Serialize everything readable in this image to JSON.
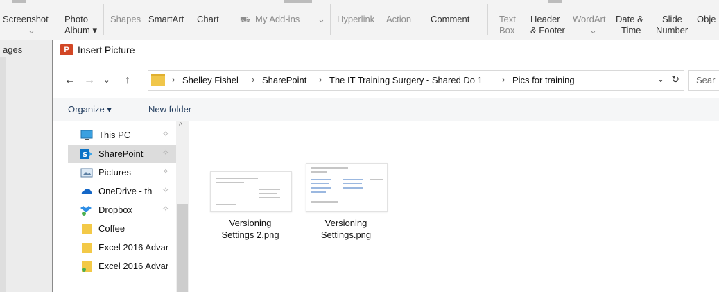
{
  "ribbon": {
    "screenshot": "Screenshot",
    "photo_album_l1": "Photo",
    "photo_album_l2": "Album ▾",
    "shapes": "Shapes",
    "smartart": "SmartArt",
    "chart": "Chart",
    "my_addins": "My Add-ins",
    "hyperlink": "Hyperlink",
    "action": "Action",
    "comment": "Comment",
    "text_box_l1": "Text",
    "text_box_l2": "Box",
    "header_footer_l1": "Header",
    "header_footer_l2": "& Footer",
    "wordart": "WordArt",
    "date_time_l1": "Date &",
    "date_time_l2": "Time",
    "slide_number_l1": "Slide",
    "slide_number_l2": "Number",
    "object": "Obje"
  },
  "background": {
    "panel_label": "ages"
  },
  "dialog": {
    "logo_text": "P",
    "title": "Insert Picture",
    "address": {
      "crumbs": [
        "Shelley Fishel",
        "SharePoint",
        "The IT Training Surgery - Shared Do 1",
        "Pics for training"
      ],
      "search_placeholder": "Sear"
    },
    "toolbar": {
      "organize": "Organize ▾",
      "new_folder": "New folder"
    },
    "nav": [
      {
        "label": "This PC",
        "icon": "computer-icon"
      },
      {
        "label": "SharePoint",
        "icon": "sharepoint-icon"
      },
      {
        "label": "Pictures",
        "icon": "pictures-icon"
      },
      {
        "label": "OneDrive - th",
        "icon": "onedrive-icon"
      },
      {
        "label": "Dropbox",
        "icon": "dropbox-icon"
      },
      {
        "label": "Coffee",
        "icon": "folder-icon"
      },
      {
        "label": "Excel 2016 Advar",
        "icon": "folder-icon"
      },
      {
        "label": "Excel 2016 Advar",
        "icon": "synced-folder-icon"
      }
    ],
    "files": [
      {
        "name_l1": "Versioning",
        "name_l2": "Settings 2.png"
      },
      {
        "name_l1": "Versioning",
        "name_l2": "Settings.png"
      }
    ]
  },
  "colors": {
    "ppt_logo": "#d24726",
    "folder": "#f0c64a",
    "selection": "#dcdcdc",
    "link_text": "#1e395b"
  }
}
